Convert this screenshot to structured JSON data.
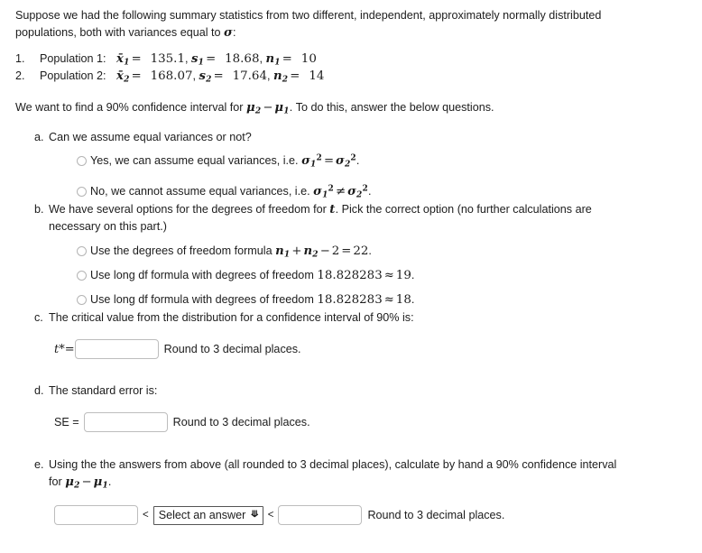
{
  "intro": {
    "line": "Suppose we had the following summary statistics from two different, independent, approximately normally distributed populations, both with variances equal to",
    "sigma": "σ",
    "colon": ":"
  },
  "populations": [
    {
      "marker": "1.",
      "label": "Population 1:",
      "mean_symbol": "x̄",
      "mean_sub": "1",
      "mean_value": "135.1",
      "sd_symbol": "s",
      "sd_sub": "1",
      "sd_value": "18.68",
      "n_symbol": "n",
      "n_sub": "1",
      "n_value": "10"
    },
    {
      "marker": "2.",
      "label": "Population 2:",
      "mean_symbol": "x̄",
      "mean_sub": "2",
      "mean_value": "168.07",
      "sd_symbol": "s",
      "sd_sub": "2",
      "sd_value": "17.64",
      "n_symbol": "n",
      "n_sub": "2",
      "n_value": "14"
    }
  ],
  "goal": {
    "before": "We want to find a 90% confidence interval for",
    "mu": "μ",
    "sub2": "2",
    "minus": "−",
    "sub1": "1",
    "after": ". To do this, answer the below questions."
  },
  "parts": {
    "a": {
      "letter": "a.",
      "text": "Can we assume equal variances or not?",
      "options": [
        {
          "prefix": "Yes, we can assume equal variances, i.e.",
          "sigma": "σ",
          "sub1": "1",
          "sup1": "2",
          "relation": "=",
          "sub2": "2",
          "sup2": "2",
          "suffix": "."
        },
        {
          "prefix": "No, we cannot assume equal variances, i.e.",
          "sigma": "σ",
          "sub1": "1",
          "sup1": "2",
          "relation": "≠",
          "sub2": "2",
          "sup2": "2",
          "suffix": "."
        }
      ]
    },
    "b": {
      "letter": "b.",
      "text_part1": "We have several options for the degrees of freedom for",
      "t_symbol": "t",
      "text_part2": ". Pick the correct option (no further calculations are necessary on this part.)",
      "options": [
        {
          "prefix": "Use the degrees of freedom formula",
          "n_symbol": "n",
          "sub1": "1",
          "plus": "+",
          "sub2": "2",
          "minus": "−",
          "two": "2",
          "equals": "=",
          "result": "22",
          "suffix": "."
        },
        {
          "prefix": "Use long df formula with degrees of freedom",
          "value": "18.828283",
          "approx": "≈",
          "result": "19",
          "suffix": "."
        },
        {
          "prefix": "Use long df formula with degrees of freedom",
          "value": "18.828283",
          "approx": "≈",
          "result": "18",
          "suffix": "."
        }
      ]
    },
    "c": {
      "letter": "c.",
      "text": "The critical value from the distribution for a confidence interval of 90% is:",
      "input_label": "t*=",
      "input_value": "",
      "note": "Round to 3 decimal places."
    },
    "d": {
      "letter": "d.",
      "text": "The standard error is:",
      "input_label": "SE =",
      "input_value": "",
      "note": "Round to 3 decimal places."
    },
    "e": {
      "letter": "e.",
      "text_before": "Using the the answers from above (all rounded to 3 decimal places), calculate by hand a 90% confidence interval for",
      "mu": "μ",
      "sub2": "2",
      "minus": "−",
      "sub1": "1",
      "text_after": ".",
      "lower_value": "",
      "less_than_1": "<",
      "dropdown_value": "Select an answer",
      "dropdown_chevron": "❯",
      "less_than_2": "<",
      "upper_value": "",
      "note": "Round to 3 decimal places."
    }
  }
}
